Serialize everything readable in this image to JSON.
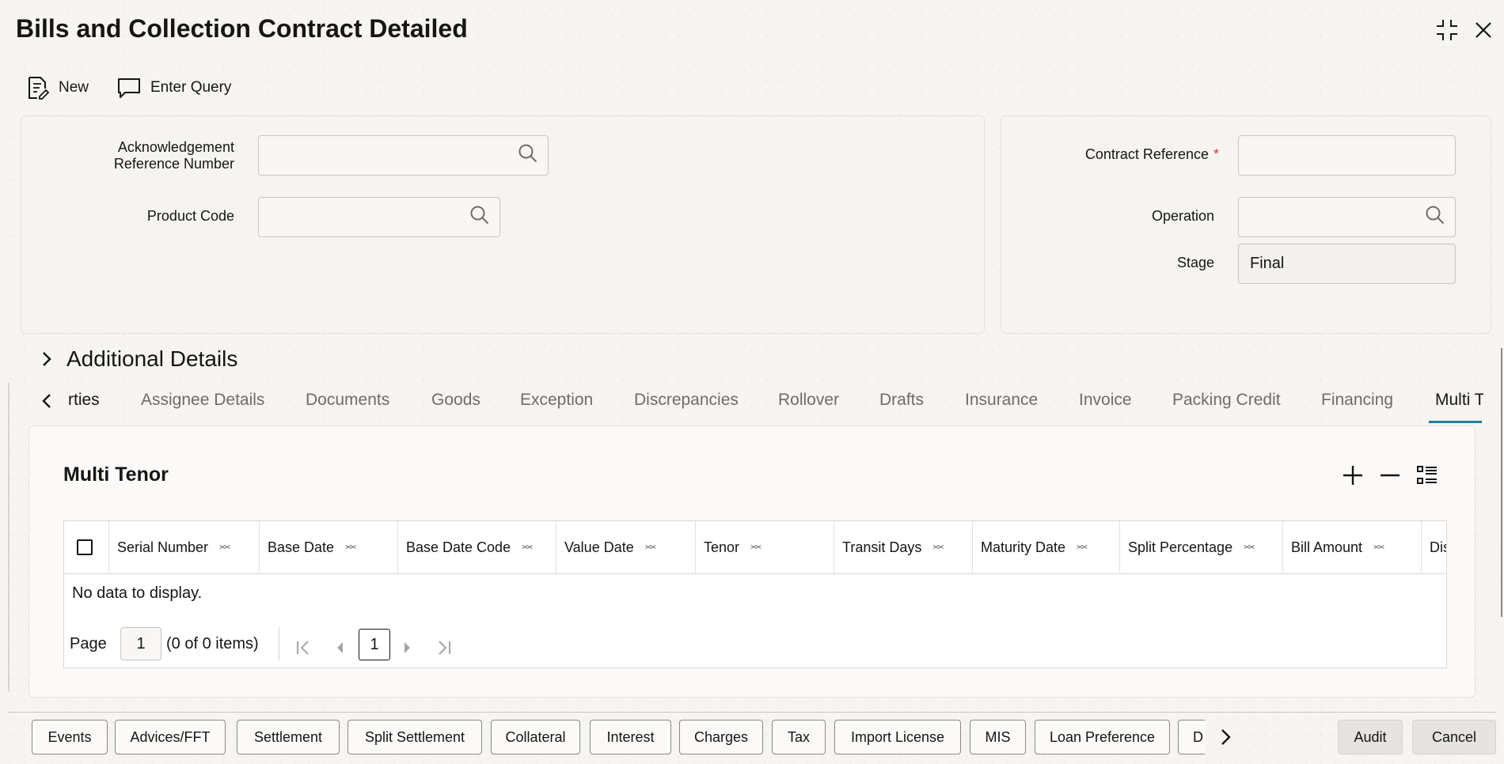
{
  "window": {
    "title": "Bills and Collection Contract Detailed"
  },
  "toolbar": {
    "new_label": "New",
    "enter_query_label": "Enter Query"
  },
  "form": {
    "ack_ref_label_line1": "Acknowledgement",
    "ack_ref_label_line2": "Reference Number",
    "ack_ref_value": "",
    "product_code_label": "Product Code",
    "product_code_value": "",
    "contract_ref_label": "Contract Reference",
    "contract_ref_required": "*",
    "contract_ref_value": "",
    "operation_label": "Operation",
    "operation_value": "",
    "stage_label": "Stage",
    "stage_value": "Final"
  },
  "additional_details": {
    "label": "Additional Details"
  },
  "tabs": [
    {
      "label": "rties"
    },
    {
      "label": "Assignee Details"
    },
    {
      "label": "Documents"
    },
    {
      "label": "Goods"
    },
    {
      "label": "Exception"
    },
    {
      "label": "Discrepancies"
    },
    {
      "label": "Rollover"
    },
    {
      "label": "Drafts"
    },
    {
      "label": "Insurance"
    },
    {
      "label": "Invoice"
    },
    {
      "label": "Packing Credit"
    },
    {
      "label": "Financing"
    },
    {
      "label": "Multi T",
      "active": true
    }
  ],
  "multi_tenor": {
    "title": "Multi Tenor",
    "columns": [
      "Serial Number",
      "Base Date",
      "Base Date Code",
      "Value Date",
      "Tenor",
      "Transit Days",
      "Maturity Date",
      "Split Percentage",
      "Bill Amount",
      "Dis"
    ],
    "empty_message": "No data to display.",
    "pagination": {
      "page_label": "Page",
      "page_value": "1",
      "items_text": "(0 of 0 items)",
      "current_page": "1"
    }
  },
  "footer": {
    "buttons": [
      "Events",
      "Advices/FFT",
      "Settlement",
      "Split Settlement",
      "Collateral",
      "Interest",
      "Charges",
      "Tax",
      "Import License",
      "MIS",
      "Loan Preference",
      "D"
    ],
    "audit_label": "Audit",
    "cancel_label": "Cancel"
  },
  "colors": {
    "accent": "#227e9e",
    "required": "#c74634",
    "background": "#f7f5f2"
  }
}
